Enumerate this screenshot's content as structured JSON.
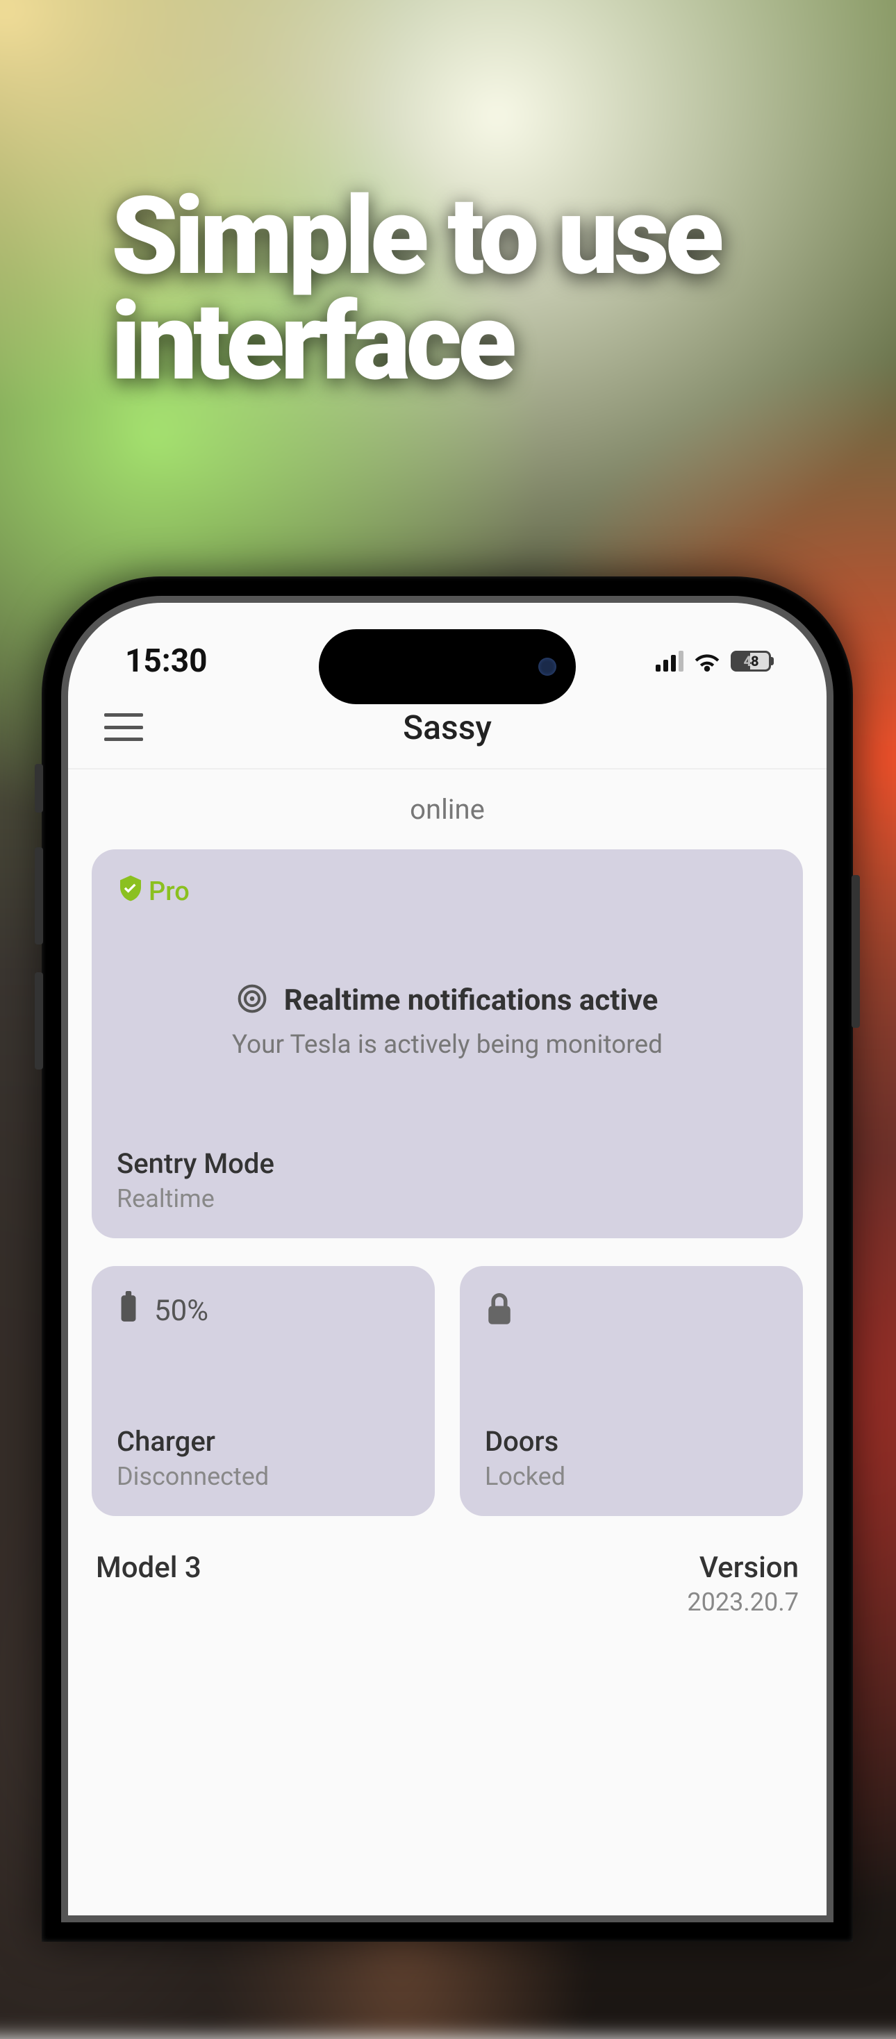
{
  "promo": {
    "title_line1": "Simple to use",
    "title_line2": "interface"
  },
  "statusbar": {
    "time": "15:30",
    "battery": "48"
  },
  "header": {
    "title": "Sassy"
  },
  "status": {
    "text": "online"
  },
  "sentry_card": {
    "badge": "Pro",
    "title": "Realtime notifications active",
    "subtitle": "Your Tesla is actively being monitored",
    "footer_title": "Sentry Mode",
    "footer_sub": "Realtime"
  },
  "charger_card": {
    "value": "50%",
    "title": "Charger",
    "sub": "Disconnected"
  },
  "doors_card": {
    "title": "Doors",
    "sub": "Locked"
  },
  "vehicle": {
    "model_label": "Model 3",
    "version_label": "Version",
    "version_value": "2023.20.7"
  }
}
